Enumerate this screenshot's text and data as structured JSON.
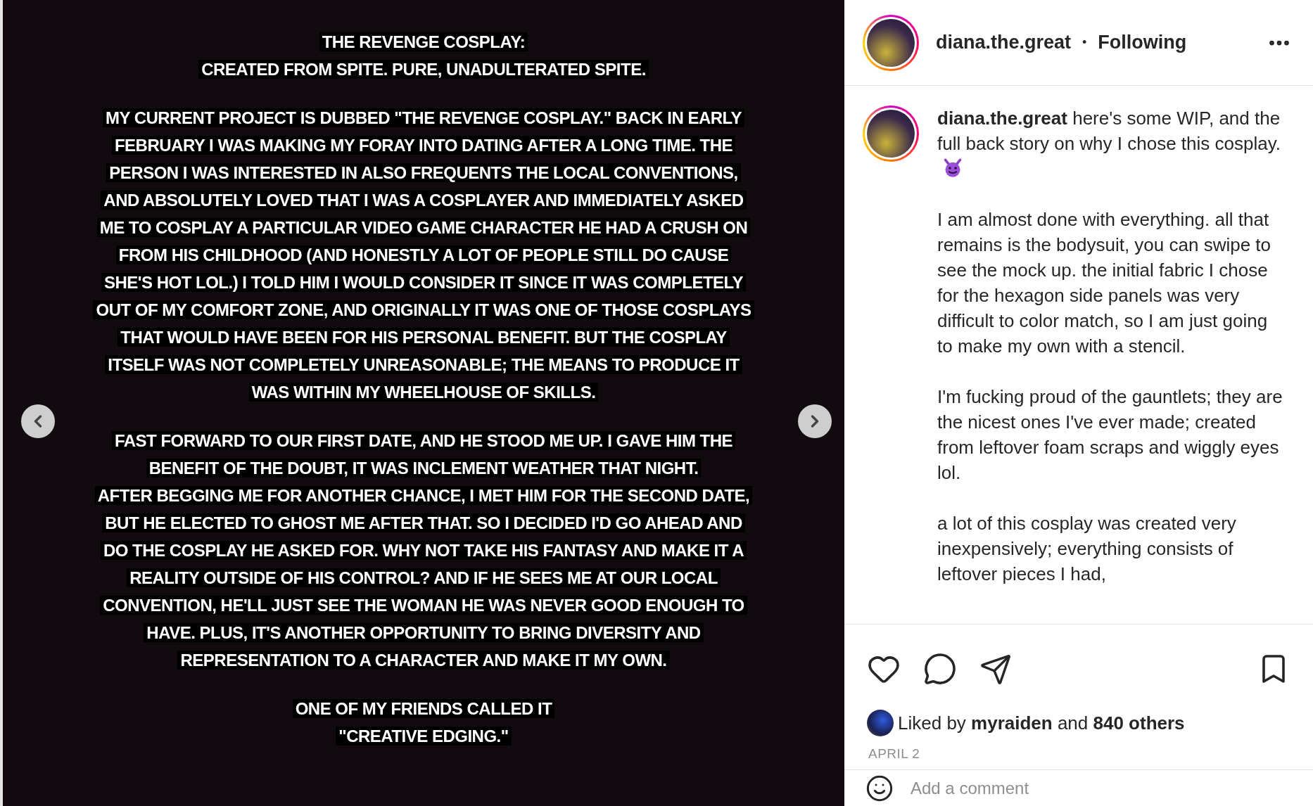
{
  "post_image": {
    "paragraphs": [
      {
        "lines": [
          "THE REVENGE COSPLAY:",
          "CREATED FROM SPITE. PURE, UNADULTERATED SPITE."
        ]
      },
      {
        "lines": [
          "MY CURRENT PROJECT IS DUBBED \"THE REVENGE COSPLAY.\" BACK IN EARLY",
          "FEBRUARY I WAS MAKING MY FORAY INTO DATING AFTER A LONG TIME. THE",
          "PERSON I WAS INTERESTED IN ALSO FREQUENTS THE LOCAL CONVENTIONS,",
          "AND ABSOLUTELY LOVED THAT I WAS A COSPLAYER AND IMMEDIATELY ASKED",
          "ME TO COSPLAY A PARTICULAR VIDEO GAME CHARACTER HE HAD A CRUSH ON",
          "FROM HIS CHILDHOOD (AND HONESTLY A LOT OF PEOPLE STILL DO CAUSE",
          "SHE'S HOT LOL.) I TOLD HIM I WOULD CONSIDER IT SINCE IT WAS COMPLETELY",
          "OUT OF MY COMFORT ZONE, AND ORIGINALLY IT WAS ONE OF THOSE COSPLAYS",
          "THAT WOULD HAVE BEEN FOR HIS PERSONAL BENEFIT. BUT THE COSPLAY",
          "ITSELF WAS NOT COMPLETELY UNREASONABLE; THE MEANS TO PRODUCE IT",
          "WAS WITHIN MY WHEELHOUSE OF SKILLS."
        ]
      },
      {
        "lines": [
          "FAST FORWARD TO OUR FIRST DATE, AND HE STOOD ME UP. I GAVE HIM THE",
          "BENEFIT OF THE DOUBT, IT WAS INCLEMENT WEATHER THAT NIGHT.",
          "AFTER BEGGING ME FOR ANOTHER CHANCE, I MET HIM FOR THE SECOND DATE,",
          "BUT HE ELECTED TO GHOST ME AFTER THAT. SO I DECIDED I'D GO AHEAD AND",
          "DO THE COSPLAY HE ASKED FOR. WHY NOT TAKE HIS FANTASY AND MAKE IT A",
          "REALITY OUTSIDE OF HIS CONTROL? AND IF HE SEES ME AT OUR LOCAL",
          "CONVENTION, HE'LL JUST SEE THE WOMAN HE WAS NEVER GOOD ENOUGH TO",
          "HAVE. PLUS, IT'S ANOTHER OPPORTUNITY TO BRING DIVERSITY AND",
          "REPRESENTATION TO A CHARACTER AND MAKE IT MY OWN."
        ]
      },
      {
        "lines": [
          "ONE OF MY FRIENDS CALLED IT",
          "\"CREATIVE EDGING.\""
        ]
      }
    ]
  },
  "header": {
    "username": "diana.the.great",
    "separator": "•",
    "follow_status": "Following"
  },
  "caption": {
    "username": "diana.the.great",
    "paragraphs": [
      "here's some WIP, and the full back story on why I chose this cosplay.",
      "I am almost done with everything. all that remains is the bodysuit, you can swipe to see the mock up. the initial fabric I chose for the hexagon side panels was very difficult to color match, so I am just going to make my own with a stencil.",
      "I'm fucking proud of the gauntlets; they are the nicest ones I've ever made; created from leftover foam scraps and wiggly eyes lol.",
      "a lot of this cosplay was created very inexpensively; everything consists of leftover pieces I had,"
    ]
  },
  "likes": "Liked by **myraiden** and **840 others**",
  "date": "APRIL 2",
  "comment": {
    "placeholder": "Add a comment"
  }
}
